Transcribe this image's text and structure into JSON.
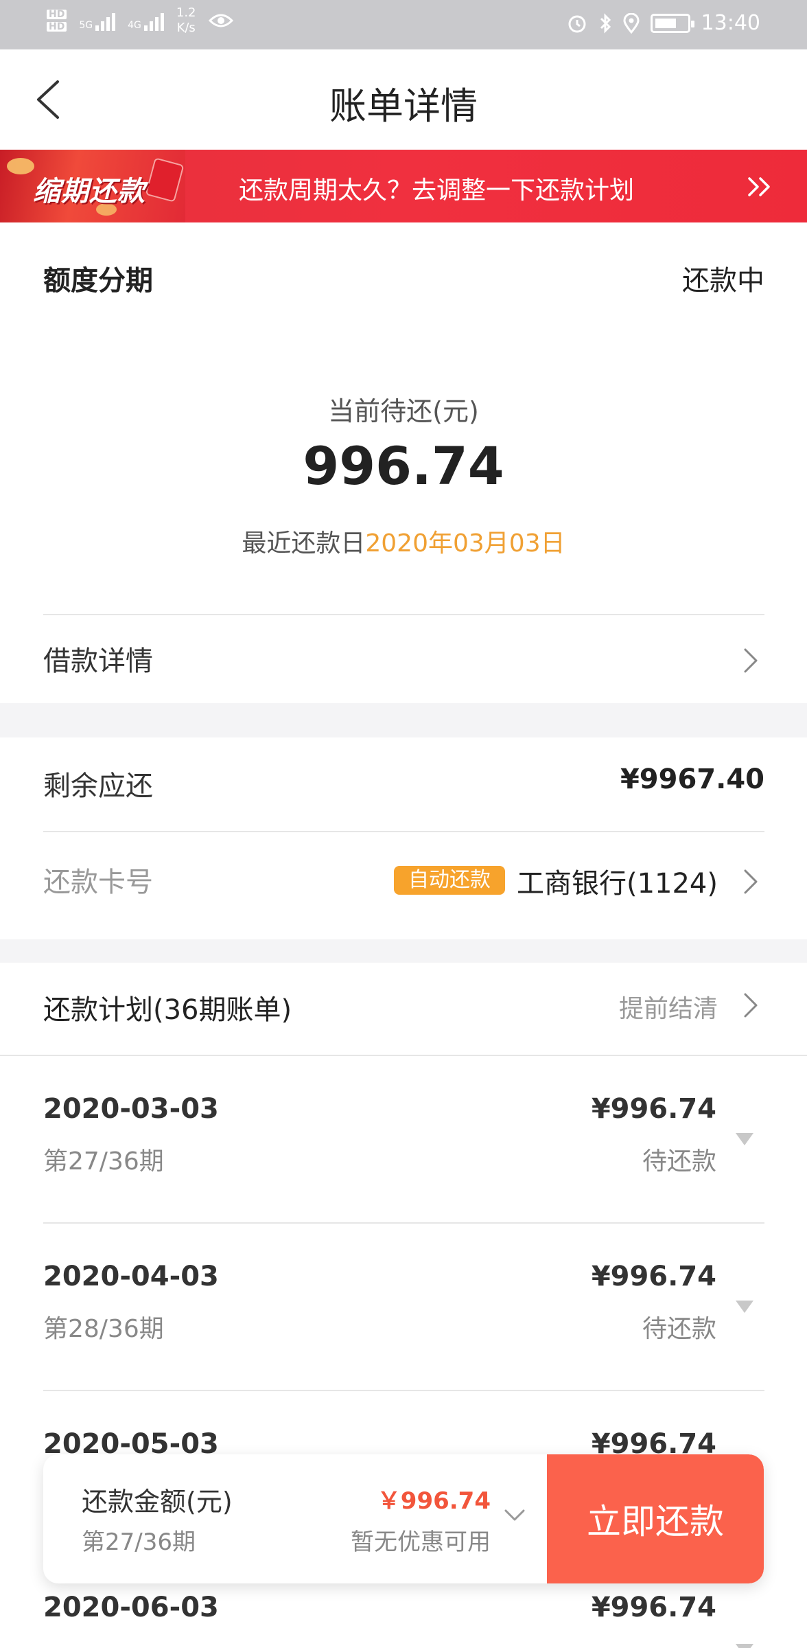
{
  "status_bar": {
    "hd1": "HD",
    "hd2": "HD",
    "net5g": "5G",
    "net4g": "4G",
    "speed_value": "1.2",
    "speed_unit": "K/s",
    "time": "13:40",
    "icons": [
      "eye-icon",
      "alarm-icon",
      "bluetooth-icon",
      "location-icon",
      "battery-icon"
    ]
  },
  "nav": {
    "title": "账单详情"
  },
  "banner": {
    "logo_text": "缩期还款",
    "text": "还款周期太久？去调整一下还款计划"
  },
  "summary": {
    "type": "额度分期",
    "status": "还款中",
    "due_label": "当前待还(元)",
    "due_amount": "996.74",
    "date_prefix": "最近还款日",
    "date_value": "2020年03月03日",
    "loan_details": "借款详情"
  },
  "remaining": {
    "label": "剩余应还",
    "amount": "¥9967.40",
    "card_label": "还款卡号",
    "auto_badge": "自动还款",
    "bank": "工商银行(1124)"
  },
  "plan": {
    "title": "还款计划(36期账单)",
    "early_settle": "提前结清",
    "items": [
      {
        "date": "2020-03-03",
        "period": "第27/36期",
        "amount": "¥996.74",
        "status": "待还款"
      },
      {
        "date": "2020-04-03",
        "period": "第28/36期",
        "amount": "¥996.74",
        "status": "待还款"
      },
      {
        "date": "2020-05-03",
        "period": "",
        "amount": "¥996.74",
        "status": ""
      },
      {
        "date": "2020-06-03",
        "period": "",
        "amount": "¥996.74",
        "status": ""
      }
    ]
  },
  "paybar": {
    "label": "还款金额(元)",
    "period": "第27/36期",
    "amount": "￥996.74",
    "discount": "暂无优惠可用",
    "button": "立即还款"
  },
  "colors": {
    "banner": "#ee2e3c",
    "accent_orange": "#f0a033",
    "pay_button": "#fb624c",
    "amount_red": "#f2553b"
  }
}
